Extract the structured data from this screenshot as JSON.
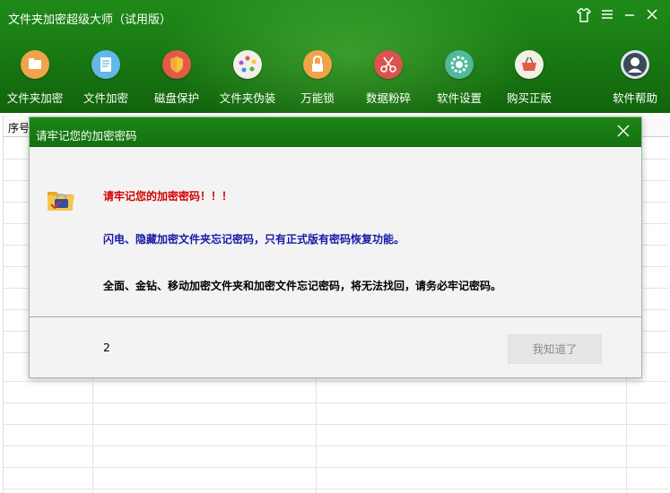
{
  "app": {
    "title": "文件夹加密超级大师（试用版）"
  },
  "toolbar": {
    "items": [
      {
        "label": "文件夹加密",
        "icon": "folder-lock-icon"
      },
      {
        "label": "文件加密",
        "icon": "file-lock-icon"
      },
      {
        "label": "磁盘保护",
        "icon": "shield-icon"
      },
      {
        "label": "文件夹伪装",
        "icon": "disguise-icon"
      },
      {
        "label": "万能锁",
        "icon": "padlock-icon"
      },
      {
        "label": "数据粉碎",
        "icon": "shredder-scissors-icon"
      },
      {
        "label": "软件设置",
        "icon": "gear-icon"
      },
      {
        "label": "购买正版",
        "icon": "basket-icon"
      },
      {
        "label": "软件帮助",
        "icon": "user-help-icon"
      }
    ]
  },
  "grid": {
    "header_first": "序号"
  },
  "dialog": {
    "title": "请牢记您的加密密码",
    "msg_warning": "请牢记您的加密密码！！！",
    "msg_info": "闪电、隐藏加密文件夹忘记密码，只有正式版有密码恢复功能。",
    "msg_notice": "全面、金钻、移动加密文件夹和加密文件忘记密码，将无法找回，请务必牢记密码。",
    "countdown": "2",
    "ok_label": "我知道了"
  }
}
